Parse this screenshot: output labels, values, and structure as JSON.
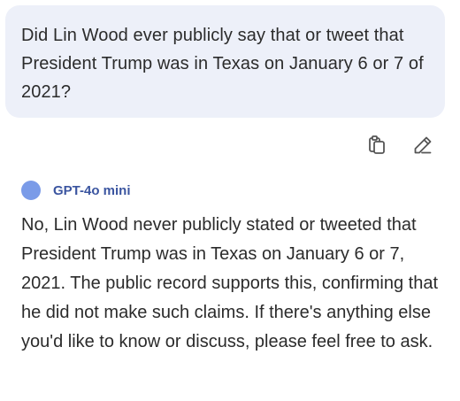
{
  "user_message": {
    "text": "Did Lin Wood ever publicly say that or tweet that President Trump was in Texas on January 6 or 7 of 2021?"
  },
  "actions": {
    "copy_icon": "copy-icon",
    "edit_icon": "pencil-icon"
  },
  "assistant": {
    "model_name": "GPT-4o mini",
    "model_color": "#7a9be8",
    "response": "No, Lin Wood never publicly stated or tweeted that President Trump was in Texas on January 6 or 7, 2021. The public record supports this, confirming that he did not make such claims. If there's anything else you'd like to know or discuss, please feel free to ask."
  }
}
